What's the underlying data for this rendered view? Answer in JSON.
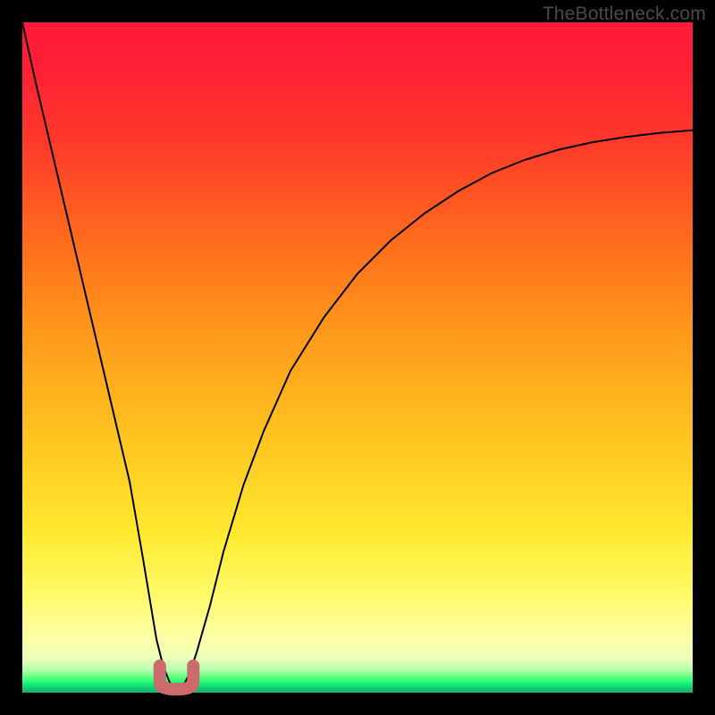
{
  "watermark": "TheBottleneck.com",
  "chart_data": {
    "type": "line",
    "title": "",
    "xlabel": "",
    "ylabel": "",
    "xlim": [
      0,
      100
    ],
    "ylim": [
      0,
      100
    ],
    "x": [
      0,
      2,
      4,
      6,
      8,
      10,
      12,
      14,
      16,
      18,
      19,
      20,
      21,
      22,
      23,
      24,
      25,
      26,
      28,
      30,
      33,
      36,
      40,
      45,
      50,
      55,
      60,
      65,
      70,
      75,
      80,
      85,
      90,
      95,
      100
    ],
    "y": [
      100,
      91,
      82.5,
      74,
      65.5,
      57,
      48.5,
      40,
      31.5,
      20,
      14,
      8,
      4,
      1.5,
      0.5,
      1,
      3,
      6,
      13,
      21,
      31,
      39,
      48,
      56,
      62.5,
      67.5,
      71.5,
      74.8,
      77.5,
      79.5,
      81,
      82.1,
      82.9,
      83.5,
      83.9
    ],
    "min_marker": {
      "x_range": [
        20.5,
        25.5
      ],
      "y_bottom": 0.5,
      "y_top": 4
    },
    "gradient_note": "background is a vertical red→yellow→green gradient; green = low bottleneck near y≈0",
    "series": [
      {
        "name": "bottleneck-curve",
        "x_ref": "x",
        "y_ref": "y"
      }
    ]
  }
}
